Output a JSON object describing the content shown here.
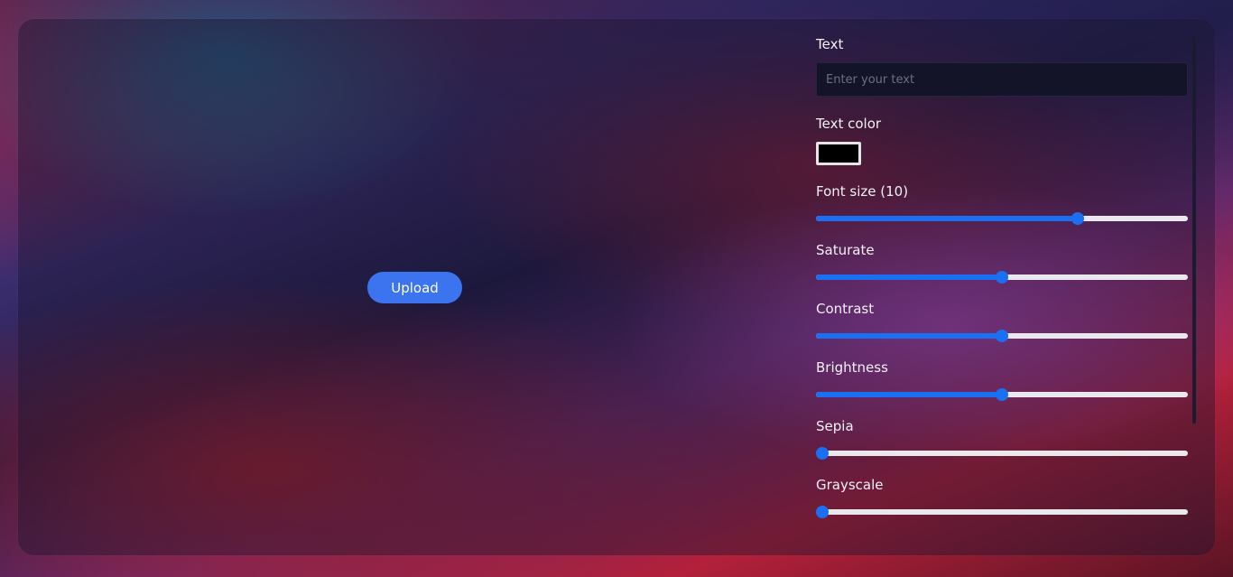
{
  "preview": {
    "upload_label": "Upload"
  },
  "controls": {
    "text": {
      "label": "Text",
      "value": "",
      "placeholder": "Enter your text"
    },
    "text_color": {
      "label": "Text color",
      "value": "#000000"
    },
    "sliders": [
      {
        "id": "font-size",
        "label": "Font size (10)",
        "value": 0.71
      },
      {
        "id": "saturate",
        "label": "Saturate",
        "value": 0.5
      },
      {
        "id": "contrast",
        "label": "Contrast",
        "value": 0.5
      },
      {
        "id": "brightness",
        "label": "Brightness",
        "value": 0.5
      },
      {
        "id": "sepia",
        "label": "Sepia",
        "value": 0.0
      },
      {
        "id": "grayscale",
        "label": "Grayscale",
        "value": 0.0
      }
    ]
  },
  "colors": {
    "accent": "#1a6ff2",
    "button": "#3b74ee"
  }
}
